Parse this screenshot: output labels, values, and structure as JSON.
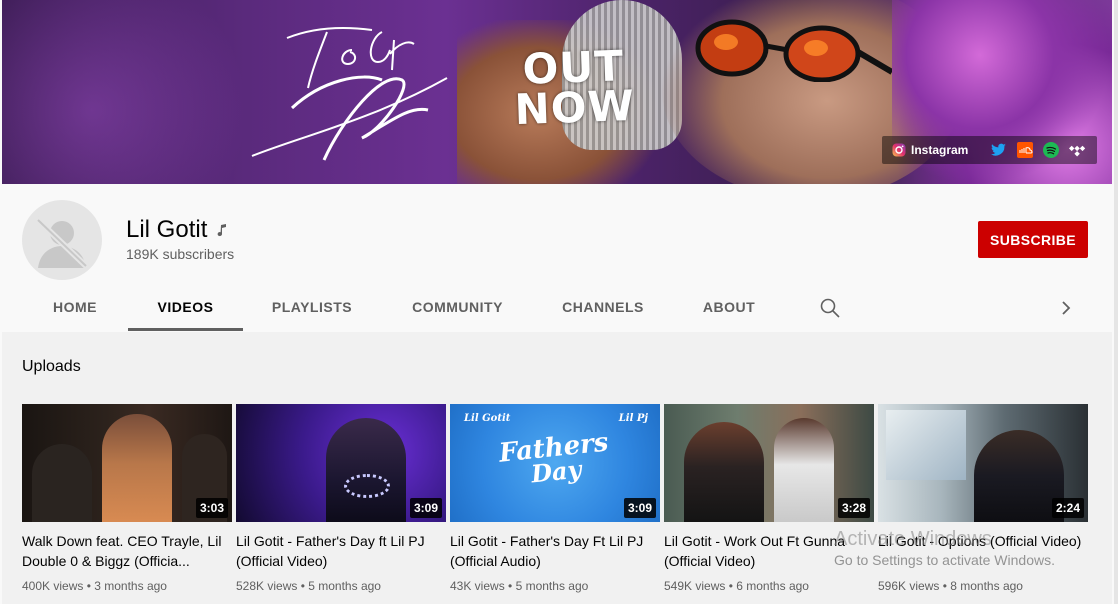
{
  "banner": {
    "headline": "OUT NOW",
    "instagram_label": "Instagram",
    "social_icons": [
      "twitter-icon",
      "soundcloud-icon",
      "spotify-icon",
      "tidal-icon"
    ]
  },
  "channel": {
    "name": "Lil Gotit",
    "subscribers": "189K subscribers",
    "subscribe_label": "SUBSCRIBE",
    "verified_icon": "music-note-icon"
  },
  "tabs": [
    {
      "label": "HOME",
      "active": false
    },
    {
      "label": "VIDEOS",
      "active": true
    },
    {
      "label": "PLAYLISTS",
      "active": false
    },
    {
      "label": "COMMUNITY",
      "active": false
    },
    {
      "label": "CHANNELS",
      "active": false
    },
    {
      "label": "ABOUT",
      "active": false
    }
  ],
  "section_title": "Uploads",
  "videos": [
    {
      "title": "Walk Down feat. CEO Trayle, Lil Double 0 & Biggz (Officia...",
      "duration": "3:03",
      "views": "400K views",
      "age": "3 months ago"
    },
    {
      "title": "Lil Gotit - Father's Day ft Lil PJ (Official Video)",
      "duration": "3:09",
      "views": "528K views",
      "age": "5 months ago"
    },
    {
      "title": "Lil Gotit - Father's Day Ft Lil PJ (Official Audio)",
      "duration": "3:09",
      "views": "43K views",
      "age": "5 months ago"
    },
    {
      "title": "Lil Gotit - Work Out Ft Gunna (Official Video)",
      "duration": "3:28",
      "views": "549K views",
      "age": "6 months ago"
    },
    {
      "title": "Lil Gotit - Options (Official Video)",
      "duration": "2:24",
      "views": "596K views",
      "age": "8 months ago"
    }
  ],
  "thumb_text": {
    "left_tag": "Lil Gotit",
    "right_tag": "Lil Pj",
    "title_line1": "Fathers",
    "title_line2": "Day"
  },
  "watermark": {
    "line1": "Activate Windows",
    "line2": "Go to Settings to activate Windows."
  },
  "colors": {
    "subscribe": "#cc0000",
    "text_primary": "#030303",
    "text_secondary": "#606060",
    "background": "#f9f9f9",
    "content_bg": "#f1f1f1"
  }
}
